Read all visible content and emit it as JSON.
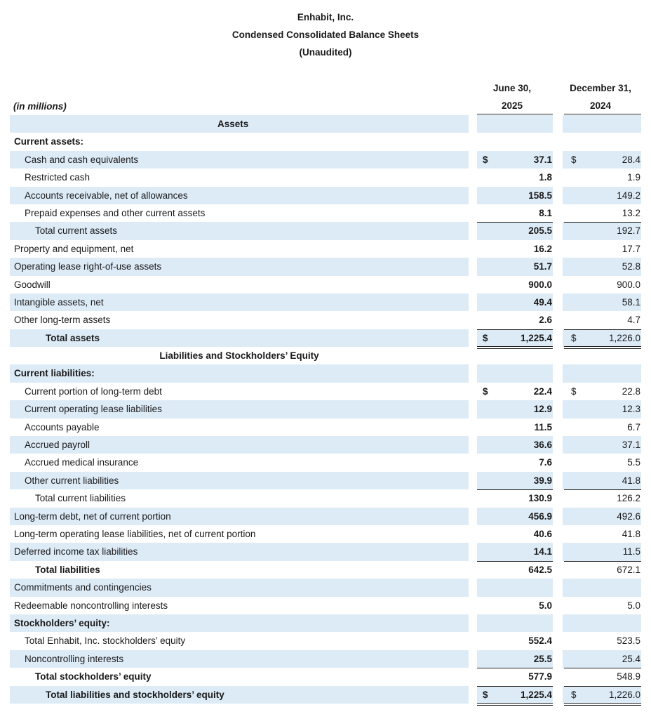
{
  "header": {
    "company": "Enhabit, Inc.",
    "statement": "Condensed Consolidated Balance Sheets",
    "note": "(Unaudited)"
  },
  "units_label": "(in millions)",
  "columns": [
    {
      "line1": "June 30,",
      "line2": "2025"
    },
    {
      "line1": "December 31,",
      "line2": "2024"
    }
  ],
  "rows": [
    {
      "label": "Assets",
      "type": "section",
      "shade": true
    },
    {
      "label": "Current assets:",
      "level": 0,
      "bold": true,
      "shade": false
    },
    {
      "label": "Cash and cash equivalents",
      "level": 1,
      "shade": true,
      "dollar": true,
      "v1": "37.1",
      "v2": "28.4"
    },
    {
      "label": "Restricted cash",
      "level": 1,
      "shade": false,
      "v1": "1.8",
      "v2": "1.9"
    },
    {
      "label": "Accounts receivable, net of allowances",
      "level": 1,
      "shade": true,
      "v1": "158.5",
      "v2": "149.2"
    },
    {
      "label": "Prepaid expenses and other current assets",
      "level": 1,
      "shade": false,
      "v1": "8.1",
      "v2": "13.2"
    },
    {
      "label": "Total current assets",
      "level": 2,
      "shade": true,
      "v1": "205.5",
      "v2": "192.7",
      "line_above": true
    },
    {
      "label": "Property and equipment, net",
      "level": 0,
      "shade": false,
      "v1": "16.2",
      "v2": "17.7"
    },
    {
      "label": "Operating lease right-of-use assets",
      "level": 0,
      "shade": true,
      "v1": "51.7",
      "v2": "52.8"
    },
    {
      "label": "Goodwill",
      "level": 0,
      "shade": false,
      "v1": "900.0",
      "v2": "900.0"
    },
    {
      "label": "Intangible assets, net",
      "level": 0,
      "shade": true,
      "v1": "49.4",
      "v2": "58.1"
    },
    {
      "label": "Other long-term assets",
      "level": 0,
      "shade": false,
      "v1": "2.6",
      "v2": "4.7"
    },
    {
      "label": "Total assets",
      "level": 3,
      "bold": true,
      "shade": true,
      "dollar": true,
      "v1": "1,225.4",
      "v2": "1,226.0",
      "line_above": true,
      "double_below": true
    },
    {
      "label": "Liabilities and Stockholders’ Equity",
      "type": "section",
      "shade": false
    },
    {
      "label": "Current liabilities:",
      "level": 0,
      "bold": true,
      "shade": true
    },
    {
      "label": "Current portion of long-term debt",
      "level": 1,
      "shade": false,
      "dollar": true,
      "v1": "22.4",
      "v2": "22.8"
    },
    {
      "label": "Current operating lease liabilities",
      "level": 1,
      "shade": true,
      "v1": "12.9",
      "v2": "12.3"
    },
    {
      "label": "Accounts payable",
      "level": 1,
      "shade": false,
      "v1": "11.5",
      "v2": "6.7"
    },
    {
      "label": "Accrued payroll",
      "level": 1,
      "shade": true,
      "v1": "36.6",
      "v2": "37.1"
    },
    {
      "label": "Accrued medical insurance",
      "level": 1,
      "shade": false,
      "v1": "7.6",
      "v2": "5.5"
    },
    {
      "label": "Other current liabilities",
      "level": 1,
      "shade": true,
      "v1": "39.9",
      "v2": "41.8"
    },
    {
      "label": "Total current liabilities",
      "level": 2,
      "shade": false,
      "v1": "130.9",
      "v2": "126.2",
      "line_above": true
    },
    {
      "label": "Long-term debt, net of current portion",
      "level": 0,
      "shade": true,
      "v1": "456.9",
      "v2": "492.6"
    },
    {
      "label": "Long-term operating lease liabilities, net of current portion",
      "level": 0,
      "shade": false,
      "v1": "40.6",
      "v2": "41.8"
    },
    {
      "label": "Deferred income tax liabilities",
      "level": 0,
      "shade": true,
      "v1": "14.1",
      "v2": "11.5"
    },
    {
      "label": "Total liabilities",
      "level": 2,
      "bold": true,
      "shade": false,
      "v1": "642.5",
      "v2": "672.1",
      "line_above": true
    },
    {
      "label": "Commitments and contingencies",
      "level": 0,
      "shade": true
    },
    {
      "label": "Redeemable noncontrolling interests",
      "level": 0,
      "shade": false,
      "v1": "5.0",
      "v2": "5.0"
    },
    {
      "label": "Stockholders’ equity:",
      "level": 0,
      "bold": true,
      "shade": true
    },
    {
      "label": "Total Enhabit, Inc. stockholders’ equity",
      "level": 1,
      "shade": false,
      "v1": "552.4",
      "v2": "523.5"
    },
    {
      "label": "Noncontrolling interests",
      "level": 1,
      "shade": true,
      "v1": "25.5",
      "v2": "25.4"
    },
    {
      "label": "Total stockholders’ equity",
      "level": 2,
      "bold": true,
      "shade": false,
      "v1": "577.9",
      "v2": "548.9",
      "line_above": true
    },
    {
      "label": "Total liabilities and stockholders’ equity",
      "level": 3,
      "bold": true,
      "shade": true,
      "dollar": true,
      "v1": "1,225.4",
      "v2": "1,226.0",
      "line_above": true,
      "double_below": true
    }
  ],
  "currency_symbol": "$"
}
